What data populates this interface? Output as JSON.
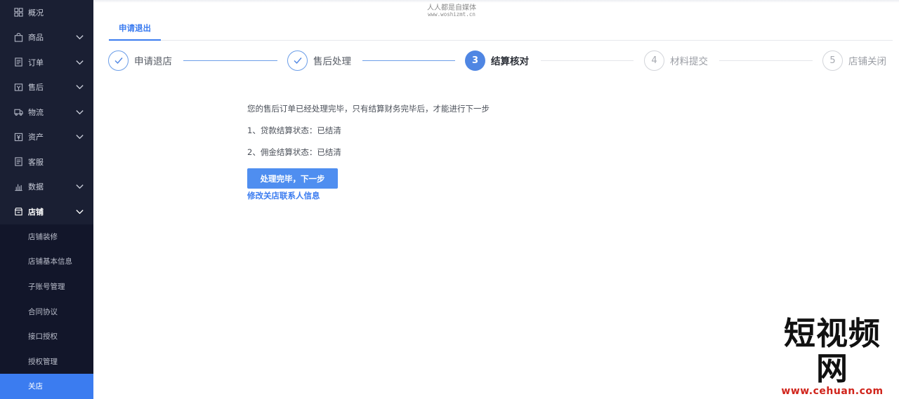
{
  "sidebar": {
    "items": [
      {
        "icon": "grid-icon",
        "label": "概况",
        "expandable": false
      },
      {
        "icon": "bag-icon",
        "label": "商品",
        "expandable": true
      },
      {
        "icon": "document-icon",
        "label": "订单",
        "expandable": true
      },
      {
        "icon": "aftersale-icon",
        "label": "售后",
        "expandable": true
      },
      {
        "icon": "truck-icon",
        "label": "物流",
        "expandable": true
      },
      {
        "icon": "yen-icon",
        "label": "资产",
        "expandable": true
      },
      {
        "icon": "document-icon",
        "label": "客服",
        "expandable": false
      },
      {
        "icon": "bar-chart-icon",
        "label": "数据",
        "expandable": true
      },
      {
        "icon": "store-icon",
        "label": "店铺",
        "expandable": true,
        "active": true
      }
    ],
    "submenu": [
      {
        "label": "店铺装修"
      },
      {
        "label": "店铺基本信息"
      },
      {
        "label": "子账号管理"
      },
      {
        "label": "合同协议"
      },
      {
        "label": "接口授权"
      },
      {
        "label": "授权管理"
      },
      {
        "label": "关店",
        "selected": true
      }
    ]
  },
  "watermark_top": {
    "cn": "人人都是自媒体",
    "en": "www.woshizmt.cn"
  },
  "tabs": [
    {
      "label": "申请退出",
      "active": true
    }
  ],
  "steps": [
    {
      "number": "1",
      "label": "申请退店",
      "state": "done"
    },
    {
      "number": "2",
      "label": "售后处理",
      "state": "done"
    },
    {
      "number": "3",
      "label": "结算核对",
      "state": "current"
    },
    {
      "number": "4",
      "label": "材料提交",
      "state": "todo"
    },
    {
      "number": "5",
      "label": "店铺关闭",
      "state": "todo"
    }
  ],
  "content": {
    "notice": "您的售后订单已经处理完毕，只有结算财务完毕后，才能进行下一步",
    "status_1": "1、贷款结算状态：已结清",
    "status_2": "2、佣金结算状态：已结清",
    "next_button": "处理完毕，下一步",
    "edit_link": "修改关店联系人信息"
  },
  "corner_watermark": {
    "title": "短视频网",
    "url": "www.cehuan.com"
  },
  "colors": {
    "sidebar_bg": "#1a1f33",
    "accent": "#3b7cf0",
    "button": "#4f8ef0"
  }
}
